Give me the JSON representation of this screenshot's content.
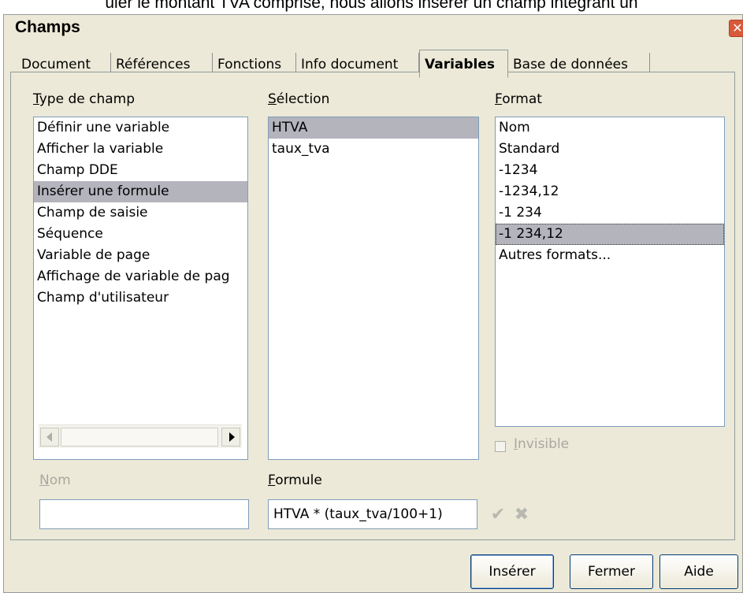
{
  "background_text": "uler le montant TVA comprise, nous allons insérer un champ intégrant un",
  "window": {
    "title": "Champs"
  },
  "tabs": [
    {
      "label": "Document",
      "active": false
    },
    {
      "label": "Références",
      "active": false
    },
    {
      "label": "Fonctions",
      "active": false
    },
    {
      "label": "Info document",
      "active": false
    },
    {
      "label": "Variables",
      "active": true
    },
    {
      "label": "Base de données",
      "active": false
    }
  ],
  "type_de_champ": {
    "label_mnemonic": "T",
    "label_rest": "ype de champ",
    "items": [
      {
        "label": "Définir une variable"
      },
      {
        "label": "Afficher la variable"
      },
      {
        "label": "Champ DDE"
      },
      {
        "label": "Insérer une formule",
        "selected": true
      },
      {
        "label": "Champ de saisie"
      },
      {
        "label": "Séquence"
      },
      {
        "label": "Variable de page"
      },
      {
        "label": "Affichage de variable de pag"
      },
      {
        "label": "Champ d'utilisateur"
      }
    ]
  },
  "selection": {
    "label_mnemonic": "S",
    "label_rest": "élection",
    "items": [
      {
        "label": "HTVA",
        "selected": true
      },
      {
        "label": "taux_tva"
      }
    ]
  },
  "format": {
    "label_mnemonic": "F",
    "label_rest": "ormat",
    "items": [
      {
        "label": "Nom"
      },
      {
        "label": "Standard"
      },
      {
        "label": "-1234"
      },
      {
        "label": "-1234,12"
      },
      {
        "label": "-1 234"
      },
      {
        "label": "-1 234,12",
        "selected": true
      },
      {
        "label": "Autres formats..."
      }
    ]
  },
  "invisible": {
    "label_mnemonic": "I",
    "label_rest": "nvisible",
    "checked": false,
    "enabled": false
  },
  "nom": {
    "label_mnemonic": "N",
    "label_rest": "om",
    "value": "",
    "enabled": false
  },
  "formule": {
    "label_mnemonic": "F",
    "label_rest": "ormule",
    "value": "HTVA * (taux_tva/100+1)"
  },
  "buttons": {
    "insert": "Insérer",
    "close": "Fermer",
    "help": "Aide"
  },
  "icons": {
    "apply": "checkmark-icon",
    "cancel": "x-icon",
    "close": "close-icon"
  },
  "colors": {
    "dialog_bg": "#ece9d8",
    "selection_bg": "#b4b4bd",
    "border": "#7f9db9"
  }
}
